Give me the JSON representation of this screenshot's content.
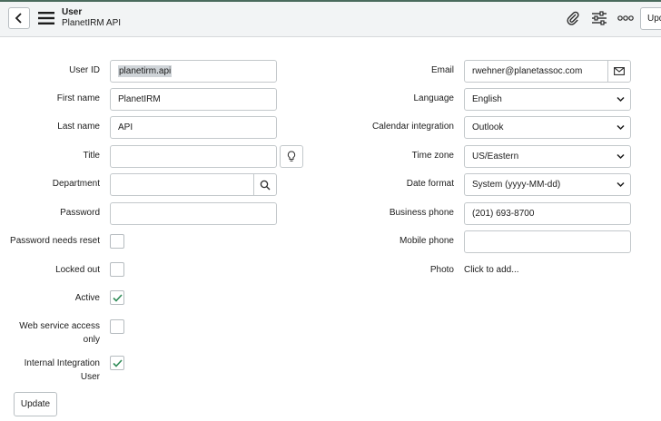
{
  "header": {
    "title": "User",
    "subtitle": "PlanetIRM API",
    "update_label": "Update"
  },
  "left": {
    "user_id": {
      "label": "User ID",
      "value": "planetirm.api"
    },
    "first_name": {
      "label": "First name",
      "value": "PlanetIRM"
    },
    "last_name": {
      "label": "Last name",
      "value": "API"
    },
    "title": {
      "label": "Title",
      "value": ""
    },
    "department": {
      "label": "Department",
      "value": ""
    },
    "password": {
      "label": "Password",
      "value": ""
    },
    "password_needs_reset": {
      "label": "Password needs reset",
      "checked": false
    },
    "locked_out": {
      "label": "Locked out",
      "checked": false
    },
    "active": {
      "label": "Active",
      "checked": true
    },
    "web_service_access_only": {
      "label_line1": "Web service access",
      "label_line2": "only",
      "checked": false
    },
    "internal_integration_user": {
      "label_line1": "Internal Integration",
      "label_line2": "User",
      "checked": true
    }
  },
  "right": {
    "email": {
      "label": "Email",
      "value": "rwehner@planetassoc.com"
    },
    "language": {
      "label": "Language",
      "value": "English"
    },
    "calendar_integration": {
      "label": "Calendar integration",
      "value": "Outlook"
    },
    "time_zone": {
      "label": "Time zone",
      "value": "US/Eastern"
    },
    "date_format": {
      "label": "Date format",
      "value": "System (yyyy-MM-dd)"
    },
    "business_phone": {
      "label": "Business phone",
      "value": "(201) 693-8700"
    },
    "mobile_phone": {
      "label": "Mobile phone",
      "value": ""
    },
    "photo": {
      "label": "Photo",
      "value": "Click to add..."
    }
  },
  "footer": {
    "update_label": "Update"
  },
  "colors": {
    "accent": "#4a6b5d",
    "check": "#2e8b57"
  }
}
